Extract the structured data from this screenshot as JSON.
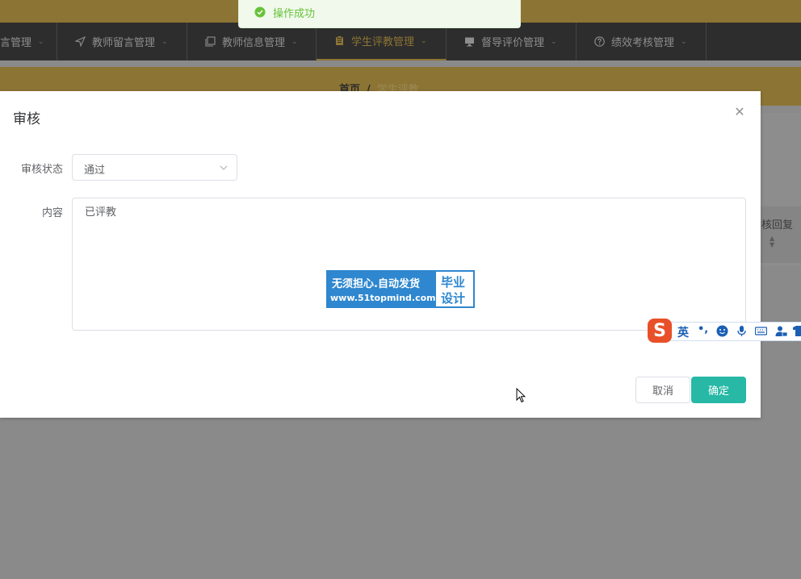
{
  "toast": {
    "message": "操作成功",
    "icon": "success-check-icon"
  },
  "nav": {
    "items": [
      {
        "label": "言管理",
        "icon": "none"
      },
      {
        "label": "教师留言管理",
        "icon": "send-icon"
      },
      {
        "label": "教师信息管理",
        "icon": "copy-icon"
      },
      {
        "label": "学生评教管理",
        "icon": "clipboard-icon",
        "active": true
      },
      {
        "label": "督导评价管理",
        "icon": "monitor-icon"
      },
      {
        "label": "绩效考核管理",
        "icon": "question-circle-icon"
      }
    ]
  },
  "breadcrumb": {
    "home": "首页",
    "separator": "/",
    "current": "学生评教"
  },
  "background_table": {
    "column_header": "核回复"
  },
  "dialog": {
    "title": "审核",
    "status_label": "审核状态",
    "status_value": "通过",
    "content_label": "内容",
    "content_value": "已评教",
    "cancel_label": "取消",
    "confirm_label": "确定"
  },
  "watermark": {
    "line1": "无须担心.自动发货",
    "line2": "www.51topmind.com",
    "right1": "毕业",
    "right2": "设计"
  },
  "ime": {
    "logo": "S",
    "language": "英",
    "punct": "•,"
  },
  "colors": {
    "brand_gold": "#8c7434",
    "nav_dark": "#2d2d2d",
    "primary_button": "#27b8a6",
    "success_text": "#67c23a",
    "watermark_blue": "#2e87cf"
  }
}
